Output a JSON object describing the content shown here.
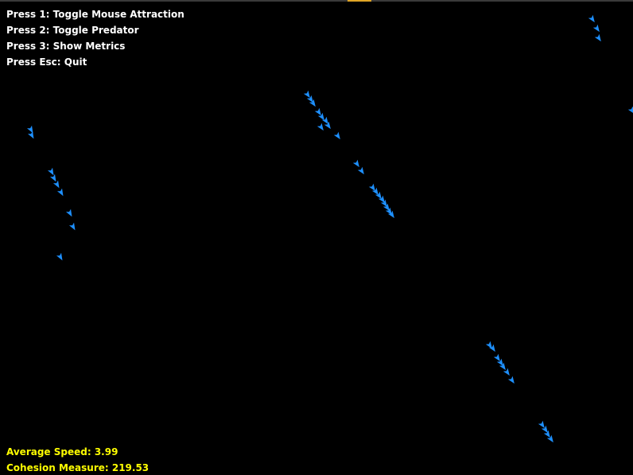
{
  "controls": {
    "line1": "Press 1: Toggle Mouse Attraction",
    "line2": "Press 2: Toggle Predator",
    "line3": "Press 3: Show Metrics",
    "line4": "Press Esc: Quit"
  },
  "metrics": {
    "average_speed": "Average Speed: 3.99",
    "cohesion": "Cohesion Measure: 219.53"
  },
  "colors": {
    "background": "#000000",
    "boid": "#1e90ff",
    "controls_text": "#ffffff",
    "metrics_text": "#ffff00"
  },
  "boid_icon": "blue-arrowhead-triangle"
}
